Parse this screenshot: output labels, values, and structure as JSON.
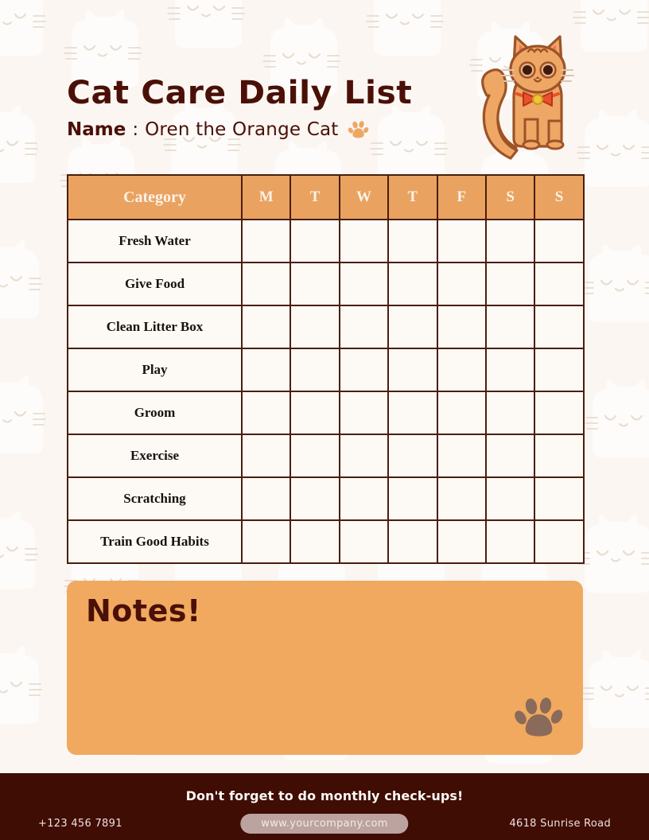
{
  "document": {
    "title": "Cat Care Daily List",
    "name_label": "Name",
    "name_separator": ":",
    "pet_name": "Oren the Orange Cat"
  },
  "colors": {
    "page_background": "#FBF6F1",
    "accent_orange": "#E9A260",
    "notes_orange": "#F0A95F",
    "dark_brown": "#3F0D04",
    "text_brown": "#4A1008",
    "border_brown": "#4A1E0C",
    "cell_background": "#FDFAF6",
    "paw_gray_brown": "#8A6A5A",
    "url_pill": "#BCA39F"
  },
  "table": {
    "headers": [
      "Category",
      "M",
      "T",
      "W",
      "T",
      "F",
      "S",
      "S"
    ],
    "rows": [
      {
        "category": "Fresh Water",
        "checks": [
          "",
          "",
          "",
          "",
          "",
          "",
          ""
        ]
      },
      {
        "category": "Give Food",
        "checks": [
          "",
          "",
          "",
          "",
          "",
          "",
          ""
        ]
      },
      {
        "category": "Clean Litter Box",
        "checks": [
          "",
          "",
          "",
          "",
          "",
          "",
          ""
        ]
      },
      {
        "category": "Play",
        "checks": [
          "",
          "",
          "",
          "",
          "",
          "",
          ""
        ]
      },
      {
        "category": "Groom",
        "checks": [
          "",
          "",
          "",
          "",
          "",
          "",
          ""
        ]
      },
      {
        "category": "Exercise",
        "checks": [
          "",
          "",
          "",
          "",
          "",
          "",
          ""
        ]
      },
      {
        "category": "Scratching",
        "checks": [
          "",
          "",
          "",
          "",
          "",
          "",
          ""
        ]
      },
      {
        "category": "Train Good Habits",
        "checks": [
          "",
          "",
          "",
          "",
          "",
          "",
          ""
        ]
      }
    ]
  },
  "notes": {
    "title": "Notes!",
    "content": ""
  },
  "footer": {
    "tagline": "Don't forget to do monthly check-ups!",
    "phone": "+123 456 7891",
    "website": "www.yourcompany.com",
    "address": "4618 Sunrise Road"
  },
  "icons": {
    "name_paw": "paw-print-icon",
    "notes_paw": "paw-print-icon",
    "cat": "sitting-cat-illustration"
  }
}
